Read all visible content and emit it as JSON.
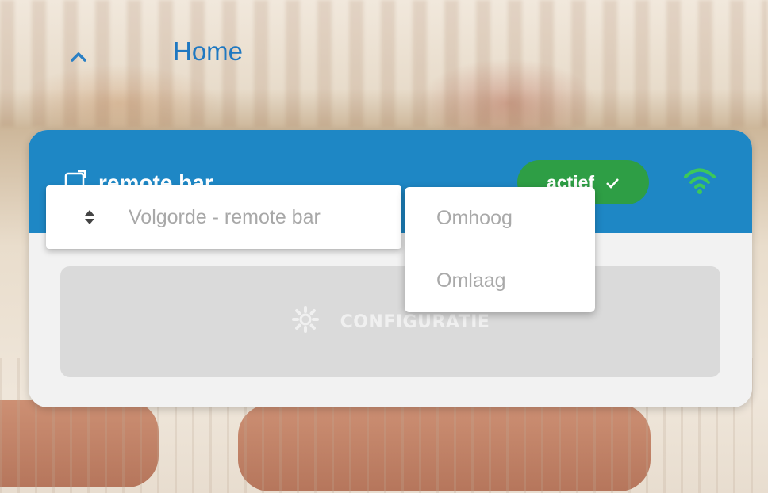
{
  "header": {
    "back_icon": "chevron-up-icon",
    "title": "Home"
  },
  "device": {
    "name": "remote bar",
    "icon": "remote-icon",
    "status": "actief",
    "status_icon": "check-icon",
    "connection_icon": "wifi-icon"
  },
  "sort_field": {
    "icon": "sort-icon",
    "label": "Volgorde - remote bar"
  },
  "menu": {
    "items": [
      {
        "label": "Omhoog"
      },
      {
        "label": "Omlaag"
      }
    ]
  },
  "config_button": {
    "icon": "gear-icon",
    "label": "CONFIGURATIE"
  },
  "colors": {
    "accent": "#1e87c5",
    "status_green": "#2e9e45",
    "wifi_green": "#3cc85a"
  }
}
